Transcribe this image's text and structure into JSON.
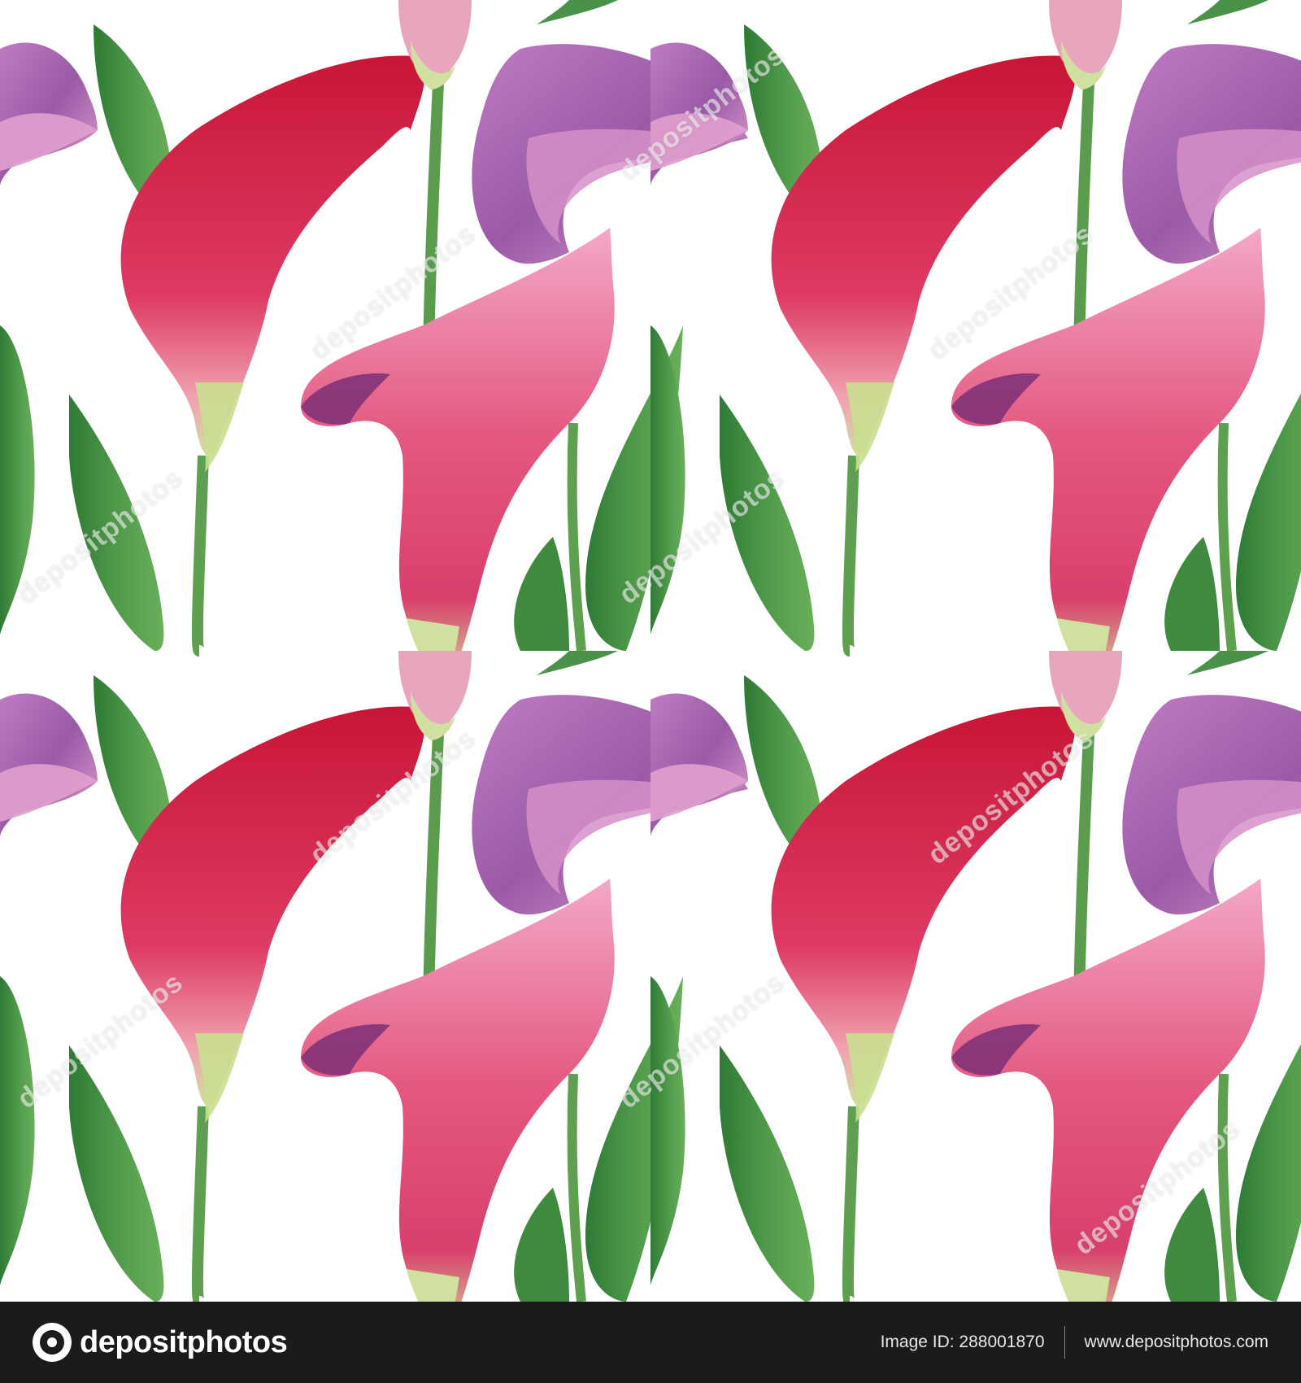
{
  "watermark": {
    "text": "depositphotos"
  },
  "footer": {
    "logo_text": "depositphotos",
    "image_id": "Image ID: 288001870",
    "site_url": "www.depositphotos.com"
  },
  "colors": {
    "background": "#ffffff",
    "footer_background": "#1c1b1c",
    "leaf_green": "#3f8a3f",
    "stem_green": "#5a9e4a",
    "calla_red": "#c8183c",
    "calla_pink": "#e86a9a",
    "calla_violet": "#b066a8"
  }
}
